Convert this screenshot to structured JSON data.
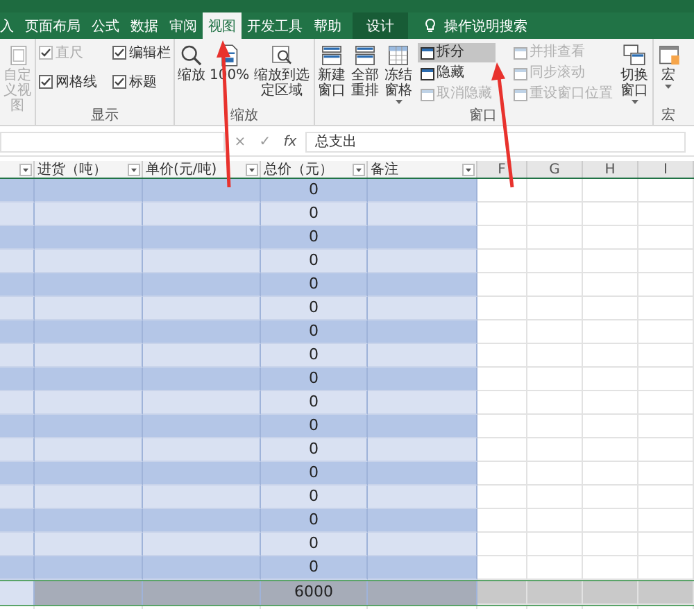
{
  "ribbon_tabs": [
    {
      "label": "入",
      "kind": "tab",
      "selected": false
    },
    {
      "label": "页面布局",
      "kind": "tab",
      "selected": false
    },
    {
      "label": "公式",
      "kind": "tab",
      "selected": false
    },
    {
      "label": "数据",
      "kind": "tab",
      "selected": false
    },
    {
      "label": "审阅",
      "kind": "tab",
      "selected": false
    },
    {
      "label": "视图",
      "kind": "tab",
      "selected": true
    },
    {
      "label": "开发工具",
      "kind": "tab",
      "selected": false
    },
    {
      "label": "帮助",
      "kind": "tab",
      "selected": false
    },
    {
      "label": "设计",
      "kind": "context",
      "selected": false
    },
    {
      "label": "操作说明搜索",
      "kind": "search",
      "selected": false
    }
  ],
  "ribbon_groups": [
    {
      "items": [
        {
          "kind": "large",
          "label": "自定义视图",
          "disabled": true
        }
      ]
    },
    {
      "label": "显示",
      "items": [
        {
          "kind": "stack",
          "items": [
            {
              "kind": "check",
              "label": "直尺",
              "checked": true,
              "disabled": true
            },
            {
              "kind": "check",
              "label": "网格线",
              "checked": true,
              "disabled": false
            }
          ]
        },
        {
          "kind": "stack",
          "items": [
            {
              "kind": "check",
              "label": "编辑栏",
              "checked": true,
              "disabled": false
            },
            {
              "kind": "check",
              "label": "标题",
              "checked": true,
              "disabled": false
            }
          ]
        }
      ]
    },
    {
      "label": "缩放",
      "items": [
        {
          "kind": "large",
          "label": "缩放",
          "disabled": false
        },
        {
          "kind": "large",
          "label": "100%",
          "disabled": false
        },
        {
          "kind": "large",
          "label": "缩放到选定区域",
          "disabled": false
        }
      ]
    },
    {
      "label": "窗口",
      "items": [
        {
          "kind": "large",
          "label": "新建窗口",
          "disabled": false
        },
        {
          "kind": "large",
          "label": "全部重排",
          "disabled": false
        },
        {
          "kind": "large",
          "label": "冻结窗格",
          "disabled": false,
          "dropdown": true
        },
        {
          "kind": "stack",
          "items": [
            {
              "kind": "small",
              "label": "拆分",
              "selected": true,
              "disabled": false
            },
            {
              "kind": "small",
              "label": "隐藏",
              "selected": false,
              "disabled": false
            },
            {
              "kind": "small",
              "label": "取消隐藏",
              "selected": false,
              "disabled": true
            }
          ]
        },
        {
          "kind": "stack",
          "items": [
            {
              "kind": "small",
              "label": "并排查看",
              "selected": false,
              "disabled": true
            },
            {
              "kind": "small",
              "label": "同步滚动",
              "selected": false,
              "disabled": true
            },
            {
              "kind": "small",
              "label": "重设窗口位置",
              "selected": false,
              "disabled": true
            }
          ]
        },
        {
          "kind": "large",
          "label": "切换窗口",
          "disabled": false,
          "dropdown": true
        }
      ]
    },
    {
      "label": "宏",
      "items": [
        {
          "kind": "large",
          "label": "宏",
          "disabled": false,
          "dropdown": true
        }
      ]
    }
  ],
  "formula_bar": {
    "cancel": "×",
    "enter": "✓",
    "fx": "fx",
    "value": "总支出"
  },
  "sheet": {
    "columns": [
      {
        "kind": "filter"
      },
      {
        "kind": "filter",
        "header": "进货（吨）"
      },
      {
        "kind": "filter",
        "header": "单价(元/吨)"
      },
      {
        "kind": "filter",
        "header": "总价（元）"
      },
      {
        "kind": "filter",
        "header": "备注"
      },
      {
        "kind": "letter",
        "header": "F"
      },
      {
        "kind": "letter",
        "header": "G"
      },
      {
        "kind": "letter",
        "header": "H"
      },
      {
        "kind": "letter",
        "header": "I"
      }
    ],
    "rows": [
      {
        "total": "0"
      },
      {
        "total": "0"
      },
      {
        "total": "0"
      },
      {
        "total": "0"
      },
      {
        "total": "0"
      },
      {
        "total": "0"
      },
      {
        "total": "0"
      },
      {
        "total": "0"
      },
      {
        "total": "0"
      },
      {
        "total": "0"
      },
      {
        "total": "0"
      },
      {
        "total": "0"
      },
      {
        "total": "0"
      },
      {
        "total": "0"
      },
      {
        "total": "0"
      },
      {
        "total": "0"
      },
      {
        "total": "0"
      }
    ],
    "total_row": {
      "total": "6000",
      "selected": true
    }
  }
}
